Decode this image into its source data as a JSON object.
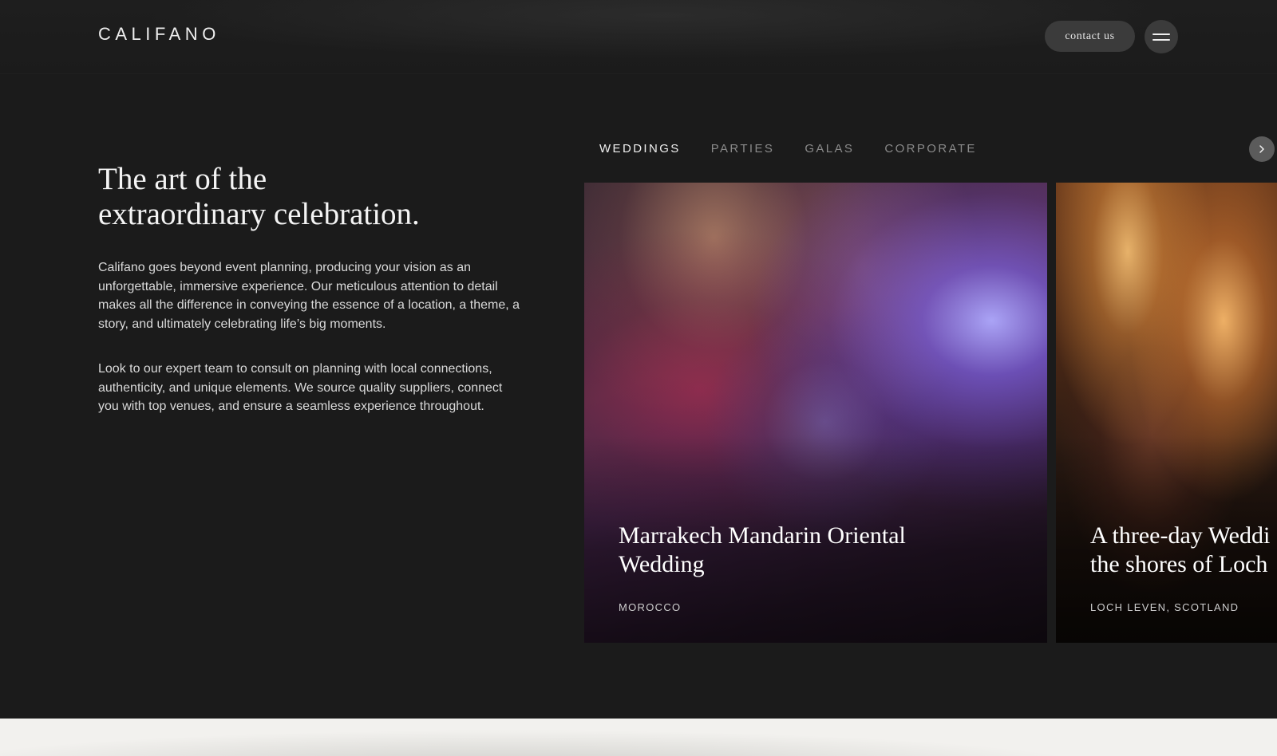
{
  "header": {
    "logo": "CALIFANO",
    "contact_label": "contact us",
    "menu_icon": "hamburger-menu-icon"
  },
  "intro": {
    "title_line1": "The art of the",
    "title_line2": "extraordinary celebration.",
    "paragraph1": "Califano goes beyond event planning, producing your vision as an unforgettable, immersive experience. Our meticulous attention to detail makes all the difference in conveying the essence of a location, a theme, a story, and ultimately celebrating life’s big moments.",
    "paragraph2": "Look to our expert team to consult on planning with local connections, authenticity, and unique elements. We source quality suppliers, connect you with top venues, and ensure a seamless experience throughout."
  },
  "tabs": [
    {
      "label": "WEDDINGS",
      "active": true
    },
    {
      "label": "PARTIES",
      "active": false
    },
    {
      "label": "GALAS",
      "active": false
    },
    {
      "label": "CORPORATE",
      "active": false
    }
  ],
  "carousel": {
    "next_icon": "chevron-right-icon",
    "cards": [
      {
        "title": "Marrakech Mandarin Oriental\nWedding",
        "location": "MOROCCO"
      },
      {
        "title_line1": "A three-day Weddi",
        "title_line2": "the shores of Loch",
        "location": "LOCH LEVEN, SCOTLAND"
      }
    ]
  }
}
